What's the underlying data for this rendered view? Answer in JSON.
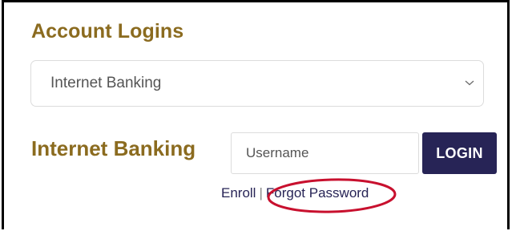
{
  "account_logins": {
    "title": "Account Logins",
    "select": {
      "value": "Internet Banking",
      "icon": "chevron-down-icon"
    }
  },
  "internet_banking": {
    "label": "Internet Banking",
    "username_placeholder": "Username",
    "username_value": "",
    "login_label": "LOGIN"
  },
  "links": {
    "enroll": "Enroll",
    "separator": "|",
    "forgot_password": "Forgot Password"
  },
  "colors": {
    "heading": "#8b6b1f",
    "login_button": "#272456",
    "link": "#272456",
    "highlight_circle": "#c8102e",
    "frame_border": "#000000"
  }
}
